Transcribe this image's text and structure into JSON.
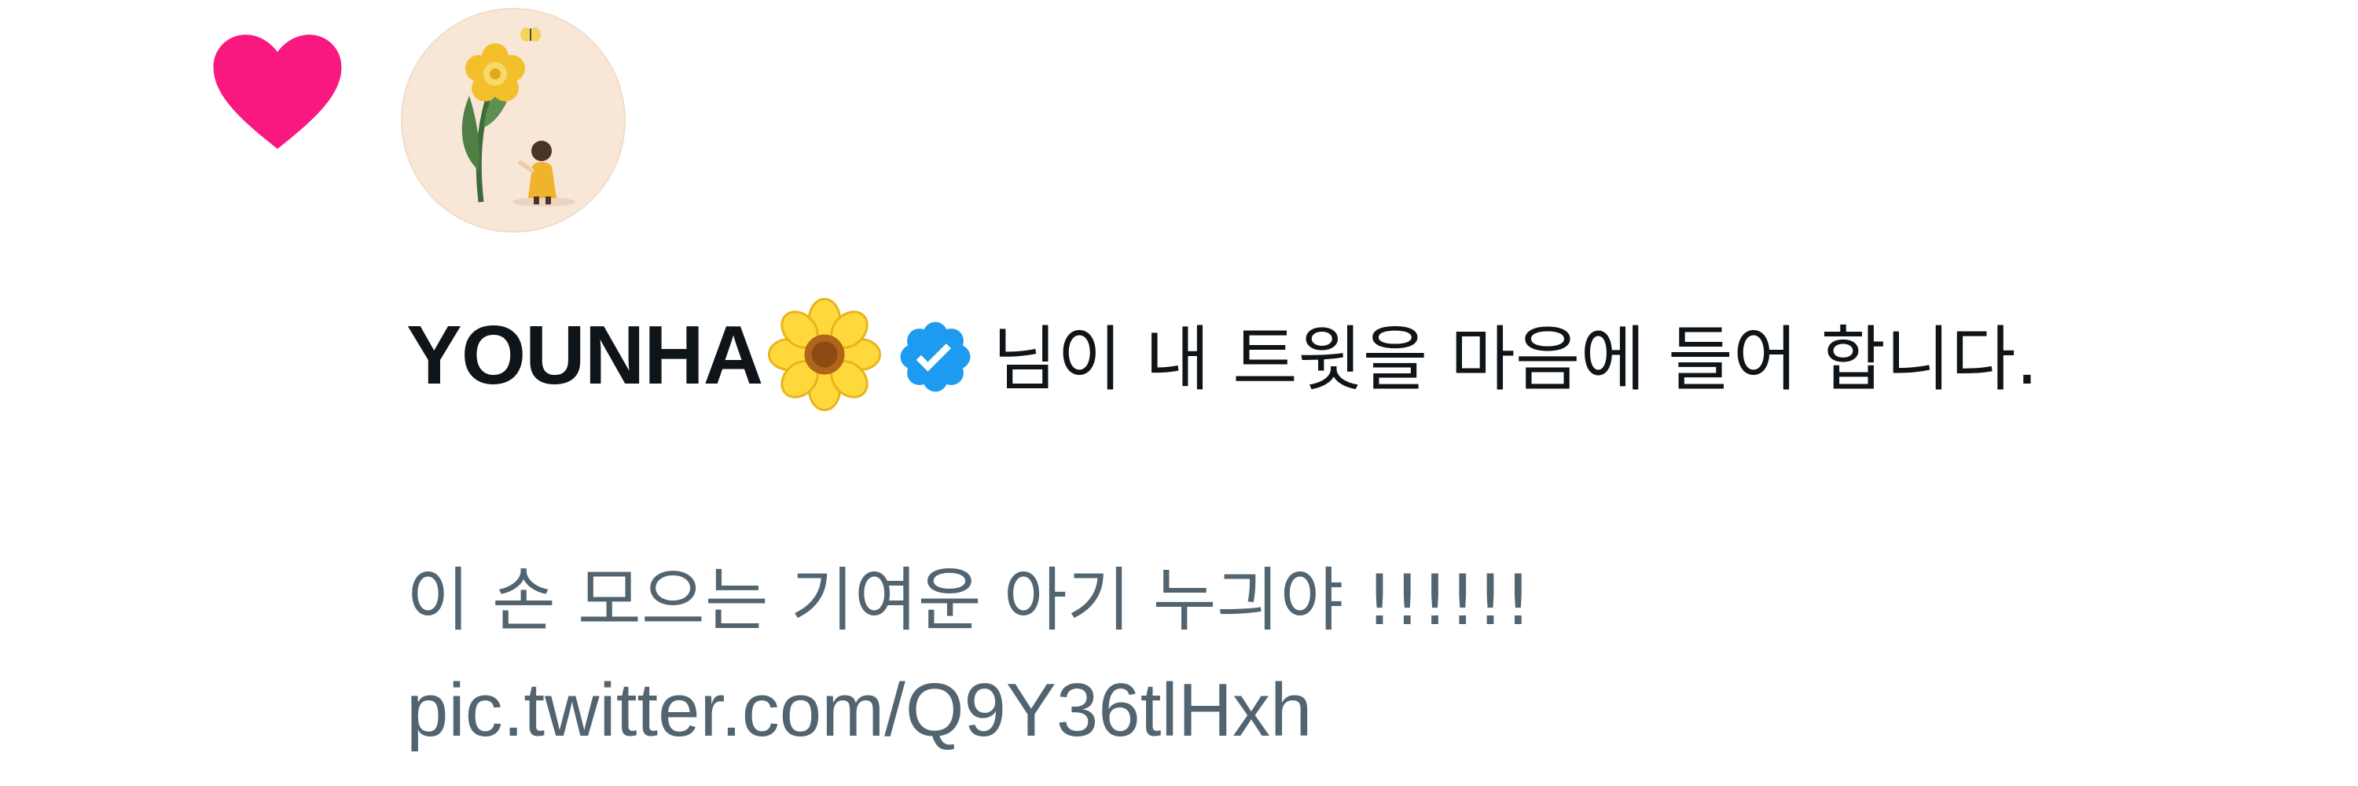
{
  "notification": {
    "user_name": "YOUNHA",
    "name_emoji": "sunflower-emoji",
    "verified_badge": "verified-check-icon",
    "action_text": "님이 내 트윗을 마음에 들어 합니다."
  },
  "tweet": {
    "text": "이 손 모으는 기여운 아기 누긔야 !!!!!!",
    "link": "pic.twitter.com/Q9Y36tlHxh"
  },
  "colors": {
    "heart": "#f91880",
    "verified": "#1d9bf0",
    "tweet_text": "#536471",
    "primary_text": "#0f1419"
  }
}
